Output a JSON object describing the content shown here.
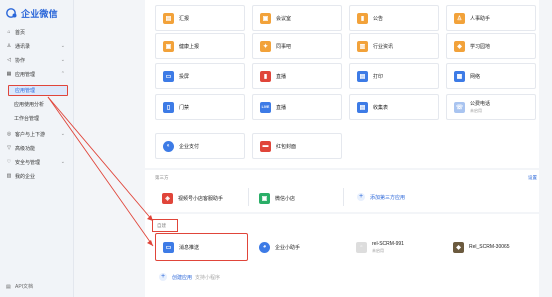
{
  "brand": {
    "name": "企业微信"
  },
  "sidebar": {
    "items": [
      {
        "label": "首页",
        "icon": "home-icon"
      },
      {
        "label": "通讯录",
        "icon": "contacts-icon"
      },
      {
        "label": "协作",
        "icon": "collab-icon"
      },
      {
        "label": "应用管理",
        "icon": "apps-icon"
      },
      {
        "label": "客户与上下游",
        "icon": "customer-icon"
      },
      {
        "label": "高级功能",
        "icon": "advanced-icon"
      },
      {
        "label": "安全与管理",
        "icon": "security-icon"
      },
      {
        "label": "我的企业",
        "icon": "company-icon"
      }
    ],
    "sub_items": [
      {
        "label": "应用管理"
      },
      {
        "label": "应用使用分析"
      },
      {
        "label": "工作台管理"
      }
    ],
    "api_doc": "API文档"
  },
  "apps": {
    "row1": [
      "汇报",
      "会议室",
      "公告",
      "人事助手"
    ],
    "row2": [
      "健康上报",
      "同事吧",
      "行业资讯",
      "学习园地"
    ],
    "row3": [
      "投屏",
      "直播",
      "打印",
      "网络"
    ],
    "row4": [
      {
        "label": "门禁"
      },
      {
        "label": "直播",
        "badge": "LIVE"
      },
      {
        "label": "收集表"
      },
      {
        "label": "公费电话",
        "sub": "未启用"
      }
    ],
    "row5": [
      "企业支付",
      "红包封面"
    ]
  },
  "third_party": {
    "title": "第三方",
    "link": "设置",
    "items": [
      "视频号小店客服助手",
      "微信小店"
    ],
    "add_label": "添加第三方应用"
  },
  "custom": {
    "title": "自建",
    "items": [
      {
        "label": "消息推送"
      },
      {
        "label": "企业小助手"
      },
      {
        "label": "rel-SCRM-991",
        "sub": "未启用"
      },
      {
        "label": "Rel_SCRM-30065"
      }
    ],
    "add_label": "创建应用",
    "add_sub": "支持小程序"
  },
  "colors": {
    "brand": "#2a66d9",
    "highlight": "#e0453a"
  }
}
